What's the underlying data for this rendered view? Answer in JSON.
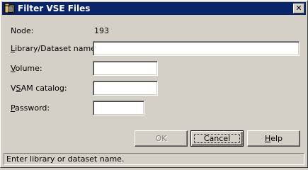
{
  "window": {
    "title": "Filter VSE Files",
    "close_symbol": "✕",
    "title_icon": "folder-filter-icon"
  },
  "form": {
    "node_label": "Node:",
    "node_value": "193",
    "library": {
      "label": "Library/Dataset name:",
      "mnemonic": "L",
      "value": ""
    },
    "volume": {
      "label": "Volume:",
      "mnemonic": "V",
      "value": ""
    },
    "vsam": {
      "label": "VSAM catalog:",
      "mnemonic": "S",
      "value": ""
    },
    "password": {
      "label": "Password:",
      "mnemonic": "P",
      "value": ""
    }
  },
  "buttons": {
    "ok": {
      "label": "OK",
      "enabled": false
    },
    "cancel": {
      "label": "Cancel",
      "default": true
    },
    "help": {
      "label": "Help",
      "mnemonic": "H"
    }
  },
  "status": {
    "text": "Enter library or dataset name."
  }
}
